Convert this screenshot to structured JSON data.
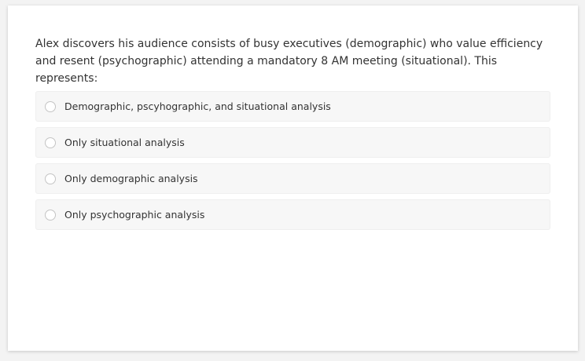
{
  "question": {
    "text": "Alex discovers his audience consists of busy executives (demographic) who value efficiency and resent (psychographic) attending a mandatory 8 AM meeting (situational). This represents:"
  },
  "options": [
    {
      "label": "Demographic, pscyhographic, and situational analysis",
      "selected": false
    },
    {
      "label": "Only situational analysis",
      "selected": false
    },
    {
      "label": "Only demographic analysis",
      "selected": false
    },
    {
      "label": "Only psychographic analysis",
      "selected": false
    }
  ],
  "colors": {
    "text": "#333333",
    "option_bg": "#f7f7f7",
    "radio_border": "#c4c4c4"
  }
}
